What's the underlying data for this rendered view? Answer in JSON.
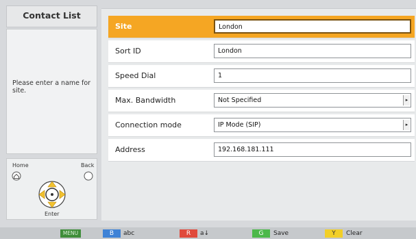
{
  "left_panel": {
    "title": "Contact List",
    "help_text": "Please enter a name for site."
  },
  "remote": {
    "home_label": "Home",
    "back_label": "Back",
    "enter_label": "Enter"
  },
  "form": {
    "rows": [
      {
        "label": "Site",
        "value": "London",
        "type": "text",
        "active": true
      },
      {
        "label": "Sort ID",
        "value": "London",
        "type": "text"
      },
      {
        "label": "Speed Dial",
        "value": "1",
        "type": "text"
      },
      {
        "label": "Max. Bandwidth",
        "value": "Not Specified",
        "type": "select"
      },
      {
        "label": "Connection mode",
        "value": "IP Mode (SIP)",
        "type": "select"
      },
      {
        "label": "Address",
        "value": "192.168.181.111",
        "type": "text"
      }
    ]
  },
  "footer": {
    "menu_key": "MENU",
    "b_key": "B",
    "b_label": "abc",
    "r_key": "R",
    "r_label": "a↓",
    "g_key": "G",
    "g_label": "Save",
    "y_key": "Y",
    "y_label": "Clear"
  },
  "colors": {
    "active_row": "#f5a623",
    "menu": "#3f8d3a",
    "blue": "#3e82d6",
    "red": "#e04a3c",
    "green": "#4cb84a",
    "yellow": "#f2cf27"
  }
}
